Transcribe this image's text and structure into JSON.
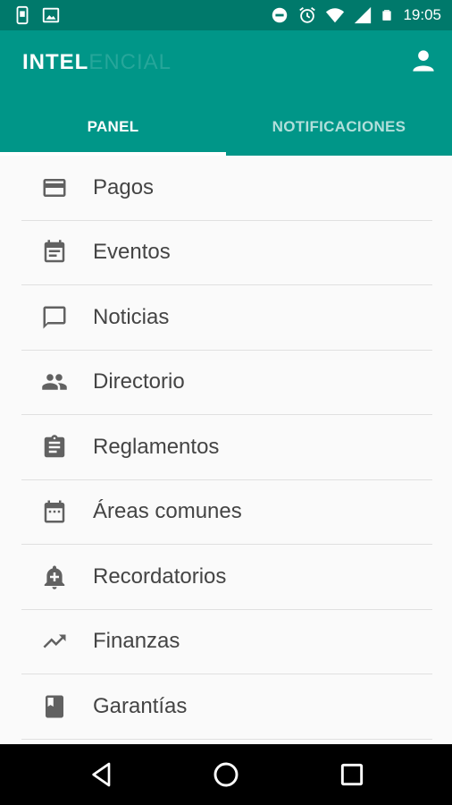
{
  "status_bar": {
    "time": "19:05",
    "icons_left": [
      "phone-screen-icon",
      "image-icon"
    ],
    "icons_right": [
      "do-not-disturb-icon",
      "alarm-icon",
      "wifi-icon",
      "signal-icon",
      "battery-icon"
    ]
  },
  "app": {
    "logo_part1": "INTEL",
    "logo_part2": "ENCIAL",
    "profile_icon": "person-icon"
  },
  "tabs": [
    {
      "label": "PANEL",
      "active": true
    },
    {
      "label": "NOTIFICACIONES",
      "active": false
    }
  ],
  "menu": [
    {
      "label": "Pagos",
      "icon": "credit-card-icon"
    },
    {
      "label": "Eventos",
      "icon": "event-note-icon"
    },
    {
      "label": "Noticias",
      "icon": "chat-bubble-icon"
    },
    {
      "label": "Directorio",
      "icon": "people-icon"
    },
    {
      "label": "Reglamentos",
      "icon": "clipboard-icon"
    },
    {
      "label": "Áreas comunes",
      "icon": "calendar-icon"
    },
    {
      "label": "Recordatorios",
      "icon": "bell-plus-icon"
    },
    {
      "label": "Finanzas",
      "icon": "trending-up-icon"
    },
    {
      "label": "Garantías",
      "icon": "book-icon"
    }
  ],
  "nav_bar": [
    "back-icon",
    "home-icon",
    "recents-icon"
  ],
  "colors": {
    "primary": "#009688",
    "status_bar": "#00796b",
    "tab_inactive": "#b2dfdb",
    "list_text": "#444444",
    "icon": "#616161"
  }
}
